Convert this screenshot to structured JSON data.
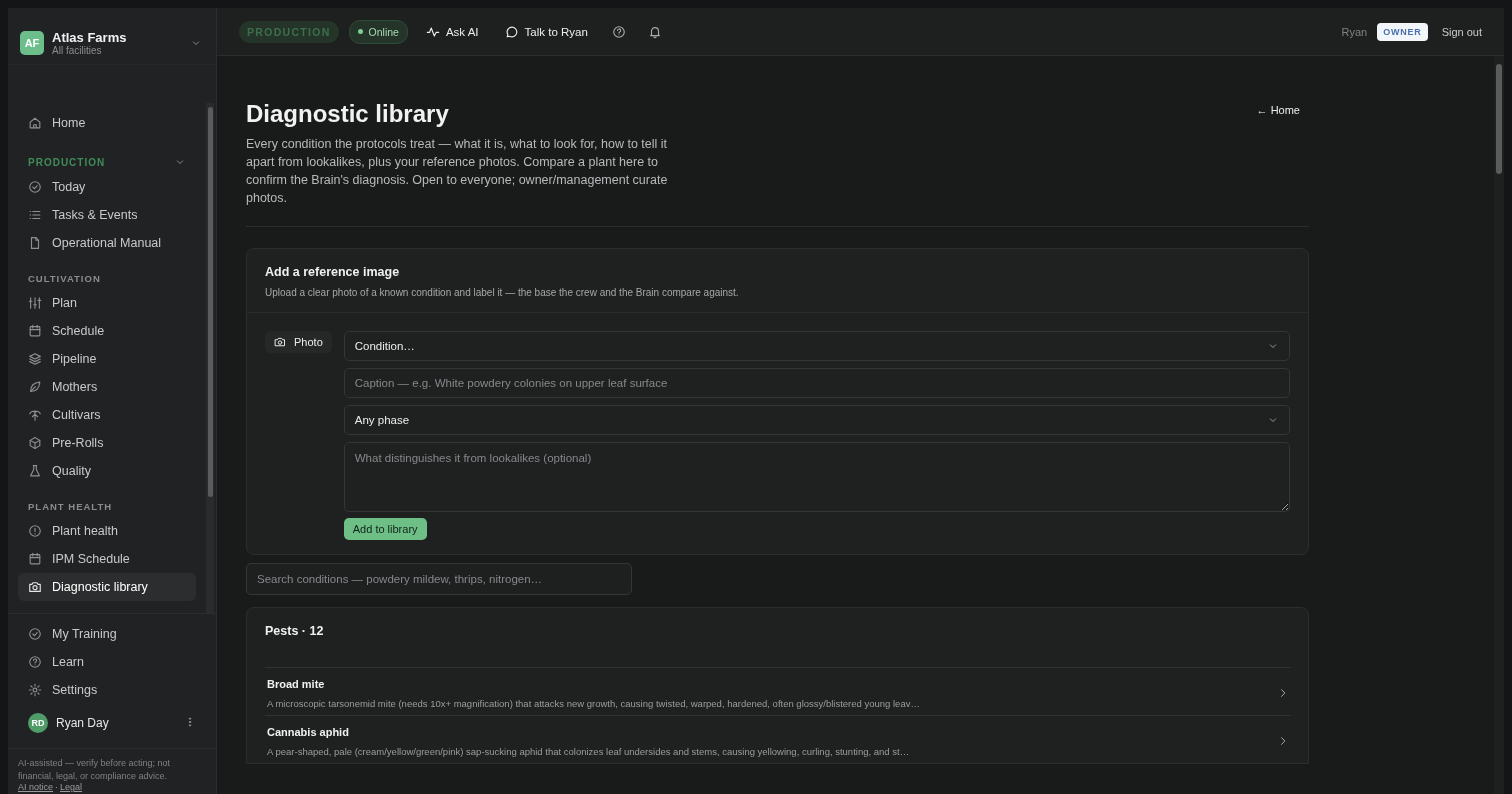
{
  "org": {
    "initials": "AF",
    "name": "Atlas Farms",
    "subtitle": "All facilities"
  },
  "topbar": {
    "mode": "PRODUCTION",
    "status": {
      "label": "Online",
      "online": true
    },
    "links": [
      "Ask AI",
      "Talk to Ryan"
    ],
    "user": "Ryan",
    "role": "OWNER",
    "sign_out": "Sign out"
  },
  "sidebar": {
    "groups": [
      {
        "items": [
          {
            "label": "Home",
            "selected": false
          }
        ]
      },
      {
        "title": "PRODUCTION",
        "kind": "primary",
        "expanded": true,
        "items": [
          {
            "label": "Today",
            "selected": false
          },
          {
            "label": "Tasks & Events",
            "selected": false
          },
          {
            "label": "Operational Manual",
            "selected": false
          }
        ]
      },
      {
        "title": "CULTIVATION",
        "kind": "plain",
        "items": [
          {
            "label": "Plan",
            "selected": false
          },
          {
            "label": "Schedule",
            "selected": false
          },
          {
            "label": "Pipeline",
            "selected": false
          },
          {
            "label": "Mothers",
            "selected": false
          },
          {
            "label": "Cultivars",
            "selected": false
          },
          {
            "label": "Pre-Rolls",
            "selected": false
          },
          {
            "label": "Quality",
            "selected": false
          }
        ]
      },
      {
        "title": "PLANT HEALTH",
        "kind": "plain",
        "items": [
          {
            "label": "Plant health",
            "selected": false
          },
          {
            "label": "IPM Schedule",
            "selected": false
          },
          {
            "label": "Diagnostic library",
            "selected": true
          }
        ]
      }
    ],
    "bottom": [
      {
        "label": "My Training"
      },
      {
        "label": "Learn"
      },
      {
        "label": "Settings"
      }
    ],
    "user": {
      "initials": "RD",
      "name": "Ryan Day"
    },
    "disclaimer": "AI-assisted — verify before acting; not financial, legal, or compliance advice.",
    "footer_links": [
      "AI notice",
      "Legal"
    ],
    "footer_separator": "·"
  },
  "page": {
    "title": "Diagnostic library",
    "back": "← Home",
    "description": "Every condition the protocols treat — what it is, what to look for, how to tell it apart from lookalikes, plus your reference photos. Compare a plant here to confirm the Brain's diagnosis. Open to everyone; owner/management curate photos."
  },
  "upload": {
    "title": "Add a reference image",
    "subtitle": "Upload a clear photo of a known condition and label it — the base the crew and the Brain compare against.",
    "photo_button": "Photo",
    "condition": {
      "value": "Condition…"
    },
    "caption": {
      "placeholder": "Caption — e.g. White powdery colonies on upper leaf surface"
    },
    "phase": {
      "value": "Any phase"
    },
    "notes": {
      "placeholder": "What distinguishes it from lookalikes (optional)"
    },
    "submit": "Add to library"
  },
  "search": {
    "placeholder": "Search conditions — powdery mildew, thrips, nitrogen…"
  },
  "category": {
    "title": "Pests · 12",
    "conditions": [
      {
        "name": "Broad mite",
        "description": "A microscopic tarsonemid mite (needs 10x+ magnification) that attacks new growth, causing twisted, warped, hardened, often glossy/blistered young leav…"
      },
      {
        "name": "Cannabis aphid",
        "description": "A pear-shaped, pale (cream/yellow/green/pink) sap-sucking aphid that colonizes leaf undersides and stems, causing yellowing, curling, stunting, and st…"
      }
    ]
  }
}
